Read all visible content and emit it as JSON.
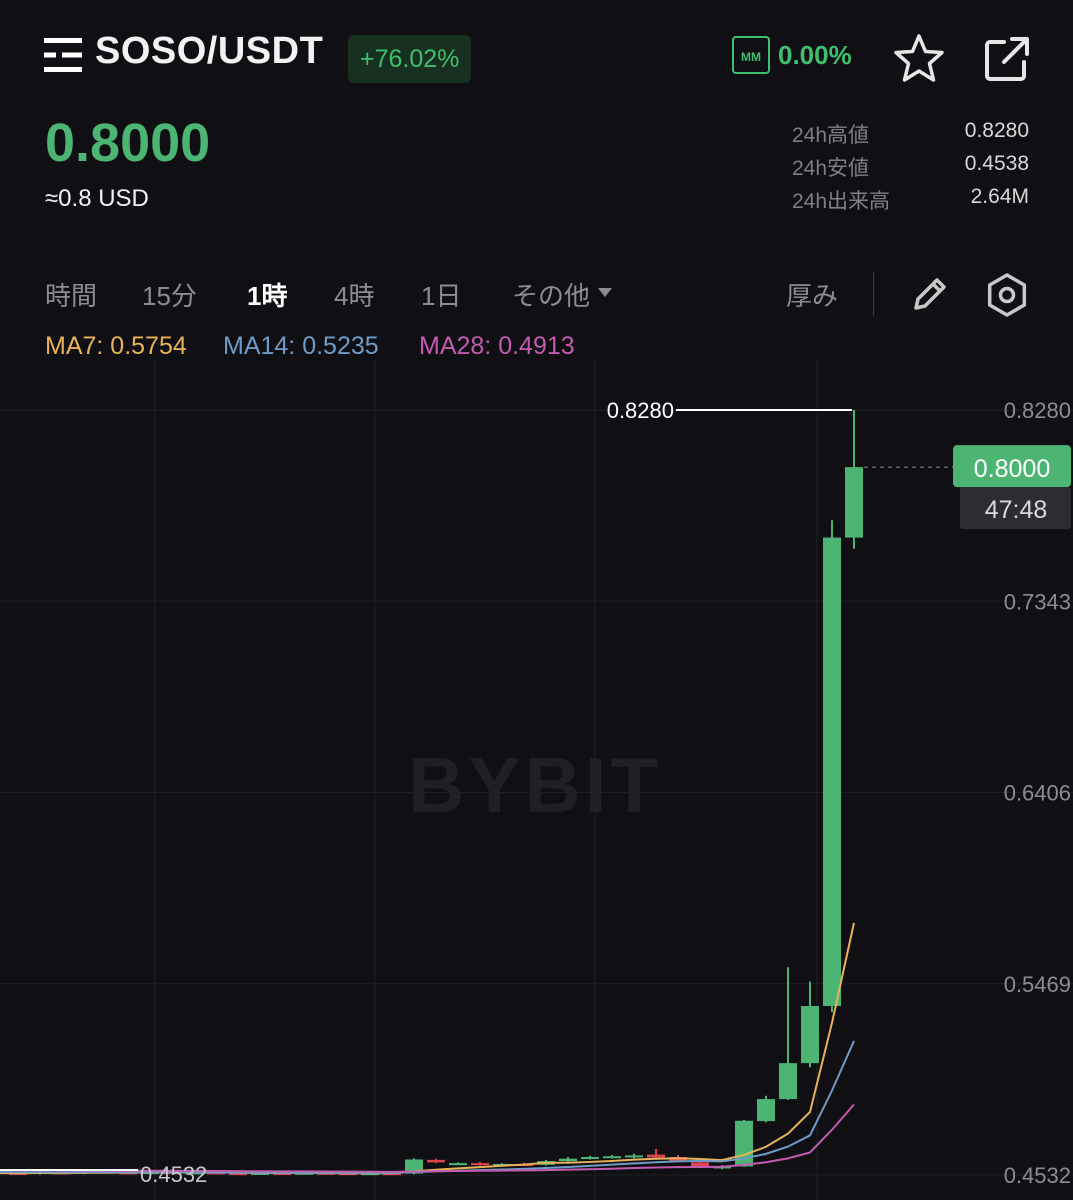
{
  "header": {
    "pair": "SOSO/USDT",
    "change": "+76.02%",
    "mm_label": "MM",
    "mm_value": "0.00%",
    "icons": [
      "menu-icon",
      "star-icon",
      "share-icon"
    ]
  },
  "price": {
    "last": "0.8000",
    "usd": "≈0.8 USD"
  },
  "stats": [
    {
      "label": "24h高値",
      "value": "0.8280"
    },
    {
      "label": "24h安値",
      "value": "0.4538"
    },
    {
      "label": "24h出来高",
      "value": "2.64M"
    }
  ],
  "toolbar": {
    "label": "時間",
    "timeframes": [
      "15分",
      "1時",
      "4時",
      "1日"
    ],
    "active": "1時",
    "more": "その他",
    "depth": "厚み",
    "icons": [
      "pencil-icon",
      "settings-icon"
    ]
  },
  "ma": [
    {
      "label": "MA7: 0.5754",
      "color": "#e8b25a"
    },
    {
      "label": "MA14: 0.5235",
      "color": "#6f9bc8"
    },
    {
      "label": "MA28: 0.4913",
      "color": "#c25cb0"
    }
  ],
  "colors": {
    "up": "#4cb574",
    "down": "#e0454f",
    "accent": "#3fbf6e",
    "background": "#101014"
  },
  "chart_data": {
    "type": "candlestick",
    "watermark": "BYBIT",
    "y_ticks": [
      "0.8280",
      "0.7343",
      "0.6406",
      "0.5469",
      "0.4532"
    ],
    "ylim": [
      0.4532,
      0.828
    ],
    "high_marker": "0.8280",
    "low_marker": "0.4532",
    "current_price": "0.8000",
    "countdown": "47:48",
    "candles": [
      {
        "o": 0.4542,
        "h": 0.455,
        "l": 0.4535,
        "c": 0.4538
      },
      {
        "o": 0.454,
        "h": 0.4555,
        "l": 0.4534,
        "c": 0.4548
      },
      {
        "o": 0.4545,
        "h": 0.4552,
        "l": 0.4538,
        "c": 0.454
      },
      {
        "o": 0.454,
        "h": 0.4556,
        "l": 0.4536,
        "c": 0.455
      },
      {
        "o": 0.4548,
        "h": 0.456,
        "l": 0.454,
        "c": 0.4545
      },
      {
        "o": 0.4545,
        "h": 0.4552,
        "l": 0.4538,
        "c": 0.4542
      },
      {
        "o": 0.4542,
        "h": 0.455,
        "l": 0.4536,
        "c": 0.4546
      },
      {
        "o": 0.4546,
        "h": 0.4552,
        "l": 0.454,
        "c": 0.4543
      },
      {
        "o": 0.4543,
        "h": 0.455,
        "l": 0.4537,
        "c": 0.4545
      },
      {
        "o": 0.4545,
        "h": 0.4551,
        "l": 0.4539,
        "c": 0.4541
      },
      {
        "o": 0.4541,
        "h": 0.4548,
        "l": 0.4536,
        "c": 0.4538
      },
      {
        "o": 0.4538,
        "h": 0.4545,
        "l": 0.4533,
        "c": 0.4542
      },
      {
        "o": 0.4542,
        "h": 0.4548,
        "l": 0.4537,
        "c": 0.454
      },
      {
        "o": 0.454,
        "h": 0.4546,
        "l": 0.4536,
        "c": 0.4543
      },
      {
        "o": 0.4543,
        "h": 0.4549,
        "l": 0.4538,
        "c": 0.4541
      },
      {
        "o": 0.4541,
        "h": 0.4546,
        "l": 0.4535,
        "c": 0.4538
      },
      {
        "o": 0.4538,
        "h": 0.4545,
        "l": 0.4534,
        "c": 0.4541
      },
      {
        "o": 0.4541,
        "h": 0.4547,
        "l": 0.4536,
        "c": 0.4539
      },
      {
        "o": 0.4539,
        "h": 0.4614,
        "l": 0.4536,
        "c": 0.4608
      },
      {
        "o": 0.4606,
        "h": 0.4612,
        "l": 0.459,
        "c": 0.4594
      },
      {
        "o": 0.4588,
        "h": 0.4594,
        "l": 0.4582,
        "c": 0.459
      },
      {
        "o": 0.459,
        "h": 0.4596,
        "l": 0.4578,
        "c": 0.4584
      },
      {
        "o": 0.4584,
        "h": 0.459,
        "l": 0.4578,
        "c": 0.4586
      },
      {
        "o": 0.4586,
        "h": 0.4592,
        "l": 0.4576,
        "c": 0.458
      },
      {
        "o": 0.4582,
        "h": 0.4606,
        "l": 0.4578,
        "c": 0.46
      },
      {
        "o": 0.46,
        "h": 0.462,
        "l": 0.4596,
        "c": 0.4612
      },
      {
        "o": 0.4612,
        "h": 0.4626,
        "l": 0.4608,
        "c": 0.462
      },
      {
        "o": 0.462,
        "h": 0.463,
        "l": 0.4612,
        "c": 0.4624
      },
      {
        "o": 0.4624,
        "h": 0.4636,
        "l": 0.4614,
        "c": 0.4628
      },
      {
        "o": 0.4632,
        "h": 0.466,
        "l": 0.461,
        "c": 0.4618
      },
      {
        "o": 0.462,
        "h": 0.463,
        "l": 0.4594,
        "c": 0.4598
      },
      {
        "o": 0.4594,
        "h": 0.46,
        "l": 0.4568,
        "c": 0.4572
      },
      {
        "o": 0.4572,
        "h": 0.458,
        "l": 0.456,
        "c": 0.4574
      },
      {
        "o": 0.4574,
        "h": 0.4802,
        "l": 0.4572,
        "c": 0.4798
      },
      {
        "o": 0.4796,
        "h": 0.492,
        "l": 0.479,
        "c": 0.4904
      },
      {
        "o": 0.4904,
        "h": 0.555,
        "l": 0.49,
        "c": 0.508
      },
      {
        "o": 0.508,
        "h": 0.548,
        "l": 0.506,
        "c": 0.536
      },
      {
        "o": 0.536,
        "h": 0.774,
        "l": 0.533,
        "c": 0.7655
      },
      {
        "o": 0.7655,
        "h": 0.828,
        "l": 0.76,
        "c": 0.8
      }
    ]
  }
}
